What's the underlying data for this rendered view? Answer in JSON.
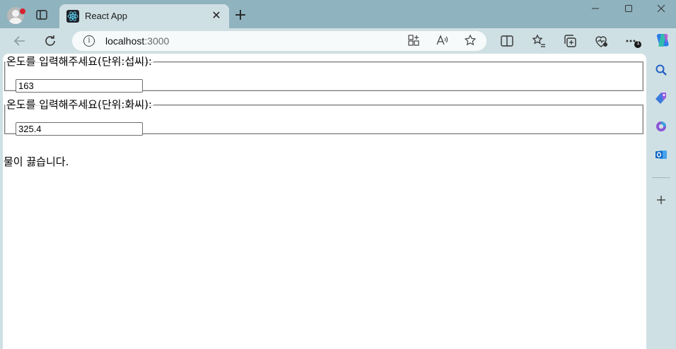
{
  "browser": {
    "tab_title": "React App",
    "url_host": "localhost",
    "url_port": ":3000",
    "notification_badge": "1"
  },
  "form": {
    "celsius": {
      "legend": "온도를 입력해주세요(단위:섭씨):",
      "value": "163"
    },
    "fahrenheit": {
      "legend": "온도를 입력해주세요(단위:화씨):",
      "value": "325.4"
    },
    "verdict": "물이 끓습니다."
  },
  "colors": {
    "titlebar": "#8fb3bf",
    "chrome": "#cfe0e4",
    "badge": "#d9232d"
  }
}
